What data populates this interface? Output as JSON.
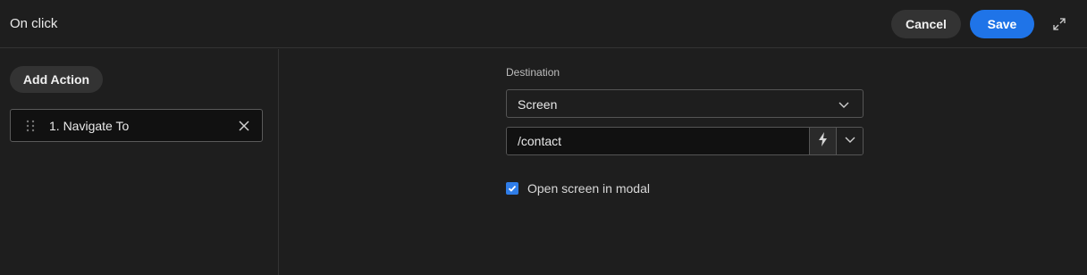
{
  "header": {
    "title": "On click",
    "cancel_label": "Cancel",
    "save_label": "Save",
    "expand_icon": "expand-icon"
  },
  "sidebar": {
    "add_action_label": "Add Action",
    "actions": [
      {
        "label": "1. Navigate To"
      }
    ]
  },
  "main": {
    "destination_label": "Destination",
    "destination_type": "Screen",
    "path_value": "/contact",
    "open_in_modal_label": "Open screen in modal",
    "open_in_modal_checked": true
  },
  "colors": {
    "accent": "#1f74e8",
    "background": "#1e1e1e"
  }
}
